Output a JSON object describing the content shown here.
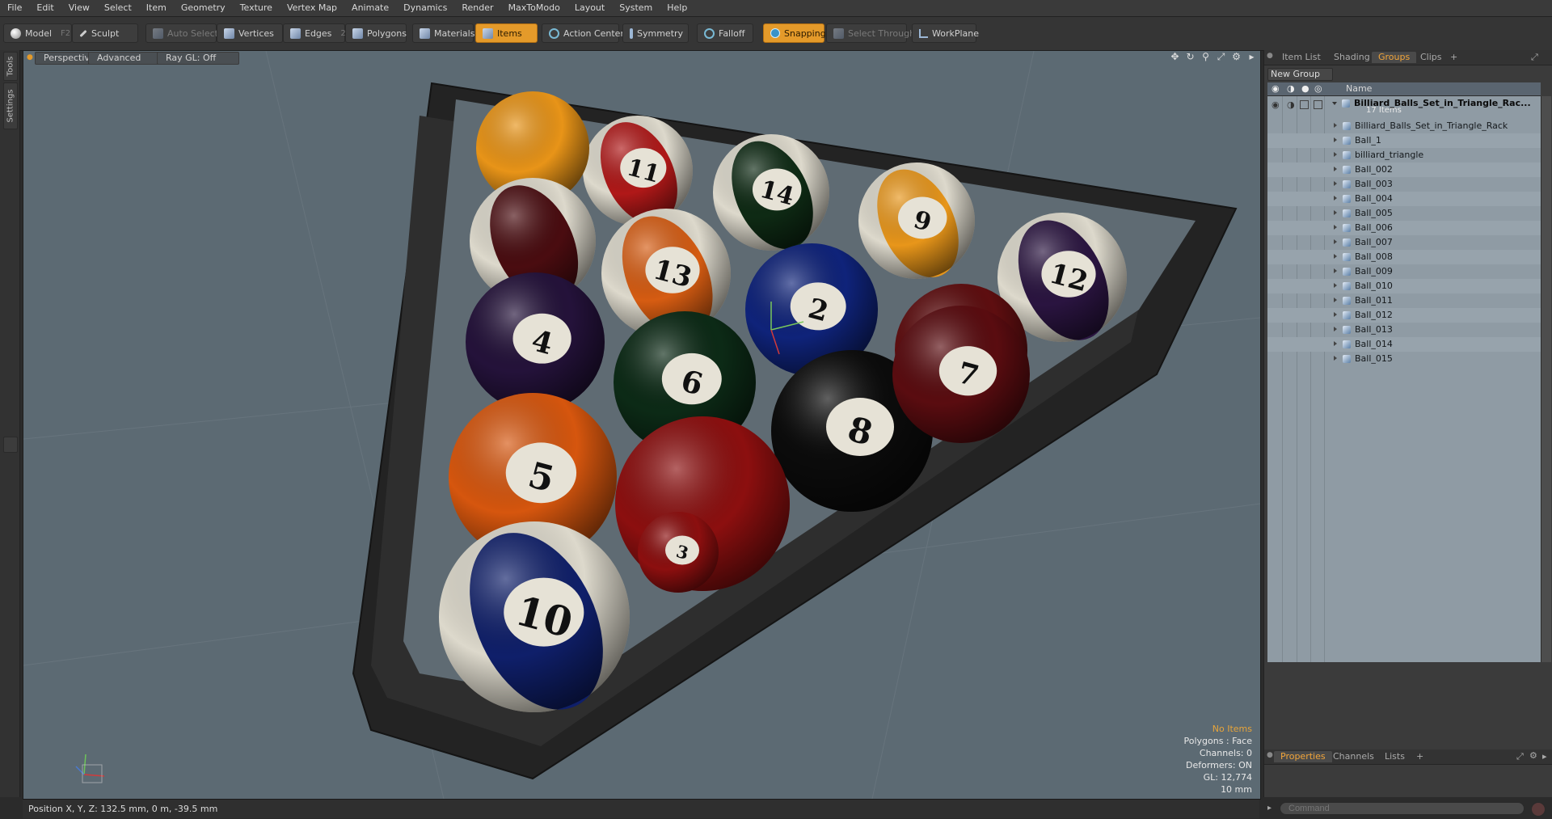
{
  "menu": [
    "File",
    "Edit",
    "View",
    "Select",
    "Item",
    "Geometry",
    "Texture",
    "Vertex Map",
    "Animate",
    "Dynamics",
    "Render",
    "MaxToModo",
    "Layout",
    "System",
    "Help"
  ],
  "toolbar": {
    "model": "Model",
    "model_key": "F2",
    "sculpt": "Sculpt",
    "auto_select": "Auto Select",
    "vertices": "Vertices",
    "vertices_key": "1",
    "edges": "Edges",
    "edges_key": "2",
    "polygons": "Polygons",
    "materials": "Materials",
    "items": "Items",
    "action_center": "Action Center",
    "symmetry": "Symmetry",
    "falloff": "Falloff",
    "snapping": "Snapping",
    "select_through": "Select Through",
    "workplane": "WorkPlane"
  },
  "left_tabs": [
    "Tools",
    "Settings"
  ],
  "viewport": {
    "view": "Perspective",
    "shading": "Advanced",
    "raygl": "Ray GL: Off",
    "hud": {
      "no_items": "No Items",
      "polygons": "Polygons : Face",
      "channels": "Channels: 0",
      "deformers": "Deformers: ON",
      "gl": "GL: 12,774",
      "scale": "10 mm"
    }
  },
  "balls": [
    {
      "n": "11",
      "color": "#b01818",
      "stripe": true
    },
    {
      "n": "",
      "color": "#e89418",
      "stripe": false
    },
    {
      "n": "14",
      "color": "#0e2a14",
      "stripe": true
    },
    {
      "n": "9",
      "color": "#e8961a",
      "stripe": true
    },
    {
      "n": "",
      "color": "#4a0c10",
      "stripe": true
    },
    {
      "n": "13",
      "color": "#d65c12",
      "stripe": true
    },
    {
      "n": "2",
      "color": "#0f237a",
      "stripe": false
    },
    {
      "n": "12",
      "color": "#2a1440",
      "stripe": true
    },
    {
      "n": "4",
      "color": "#24123a",
      "stripe": false
    },
    {
      "n": "6",
      "color": "#0c2a16",
      "stripe": false
    },
    {
      "n": "",
      "color": "#5e0e10",
      "stripe": false
    },
    {
      "n": "8",
      "color": "#0b0b0b",
      "stripe": false
    },
    {
      "n": "7",
      "color": "#5a0c10",
      "stripe": false
    },
    {
      "n": "5",
      "color": "#d6560e",
      "stripe": false
    },
    {
      "n": "",
      "color": "#8c0f0f",
      "stripe": false
    },
    {
      "n": "3",
      "color": "#8c0f0f",
      "stripe": false
    },
    {
      "n": "10",
      "color": "#0f1f6a",
      "stripe": true
    }
  ],
  "panel": {
    "tabs": [
      "Item List",
      "Shading",
      "Groups",
      "Clips"
    ],
    "active_tab": "Groups",
    "add_tab": "+",
    "new_group": "New Group",
    "name_header": "Name",
    "group_name": "Billiard_Balls_Set_in_Triangle_Rac...",
    "group_count": "17 Items",
    "items": [
      "Billiard_Balls_Set_in_Triangle_Rack",
      "Ball_1",
      "billiard_triangle",
      "Ball_002",
      "Ball_003",
      "Ball_004",
      "Ball_005",
      "Ball_006",
      "Ball_007",
      "Ball_008",
      "Ball_009",
      "Ball_010",
      "Ball_011",
      "Ball_012",
      "Ball_013",
      "Ball_014",
      "Ball_015"
    ],
    "bottom_tabs": [
      "Properties",
      "Channels",
      "Lists"
    ],
    "bottom_active": "Properties"
  },
  "status": "Position X, Y, Z:   132.5 mm, 0 m, -39.5 mm",
  "command_placeholder": "Command",
  "colors": {
    "accent": "#e49a2a",
    "viewport_bg": "#5c6a73",
    "list_bg": "#8f9ba4"
  }
}
